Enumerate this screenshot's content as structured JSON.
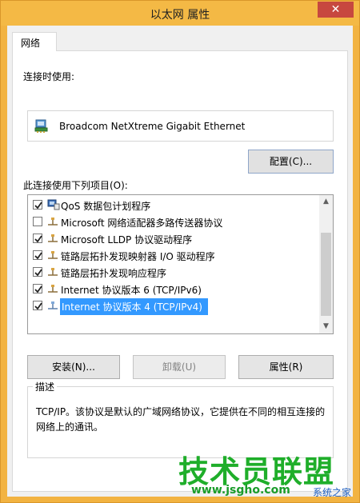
{
  "window": {
    "title": "以太网 属性",
    "close_glyph": "✕"
  },
  "tabs": [
    {
      "label": "网络"
    }
  ],
  "connect_using": {
    "label": "连接时使用:",
    "adapter_name": "Broadcom NetXtreme Gigabit Ethernet",
    "adapter_icon": "network-adapter-icon",
    "configure_button": "配置(C)..."
  },
  "items_section": {
    "label": "此连接使用下列项目(O):",
    "items": [
      {
        "label": "QoS 数据包计划程序",
        "checked": true,
        "selected": false,
        "icon": "qos-scheduler-icon"
      },
      {
        "label": "Microsoft 网络适配器多路传送器协议",
        "checked": false,
        "selected": false,
        "icon": "protocol-icon"
      },
      {
        "label": "Microsoft LLDP 协议驱动程序",
        "checked": true,
        "selected": false,
        "icon": "protocol-icon"
      },
      {
        "label": "链路层拓扑发现映射器 I/O 驱动程序",
        "checked": true,
        "selected": false,
        "icon": "protocol-icon"
      },
      {
        "label": "链路层拓扑发现响应程序",
        "checked": true,
        "selected": false,
        "icon": "protocol-icon"
      },
      {
        "label": "Internet 协议版本 6 (TCP/IPv6)",
        "checked": true,
        "selected": false,
        "icon": "protocol-icon"
      },
      {
        "label": "Internet 协议版本 4 (TCP/IPv4)",
        "checked": true,
        "selected": true,
        "icon": "protocol-icon"
      }
    ]
  },
  "buttons": {
    "install": "安装(N)...",
    "uninstall": "卸载(U)",
    "properties": "属性(R)"
  },
  "description": {
    "legend": "描述",
    "text": "TCP/IP。该协议是默认的广域网络协议，它提供在不同的相互连接的网络上的通讯。"
  },
  "watermark": {
    "title": "技术员联盟",
    "url": "www.jsgho.com",
    "sub": "系统之家"
  },
  "colors": {
    "selection": "#3399ff",
    "window_frame": "#f2b341",
    "close": "#c7483f",
    "watermark": "#1fae2a"
  }
}
